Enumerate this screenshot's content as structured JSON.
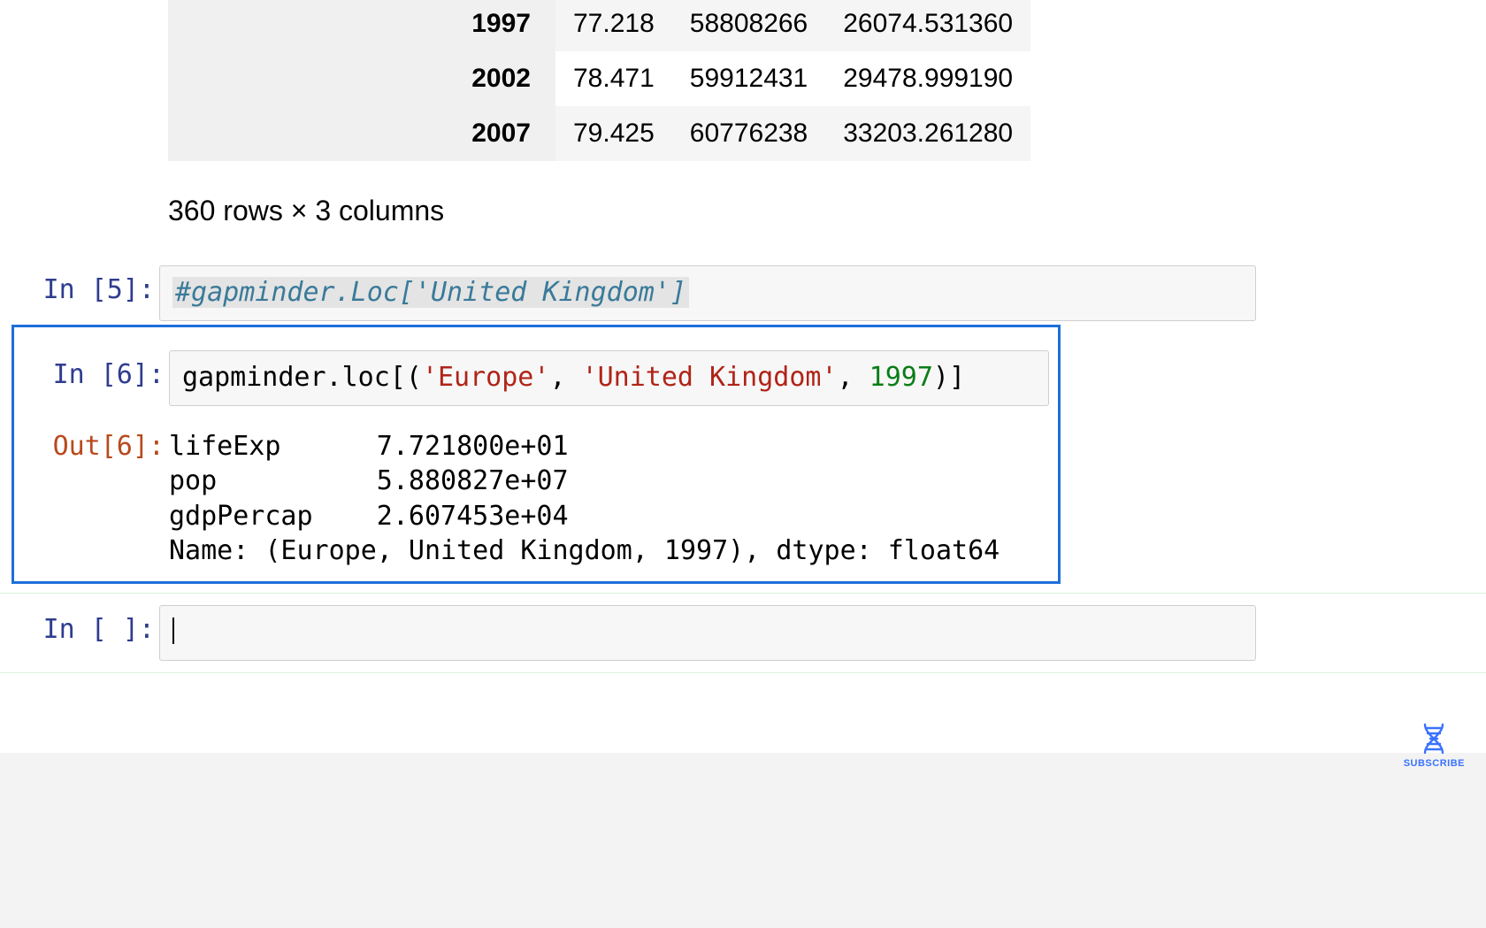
{
  "dataframe_tail": {
    "rows": [
      {
        "index": "1997",
        "lifeExp": "77.218",
        "pop": "58808266",
        "gdpPercap": "26074.531360"
      },
      {
        "index": "2002",
        "lifeExp": "78.471",
        "pop": "59912431",
        "gdpPercap": "29478.999190"
      },
      {
        "index": "2007",
        "lifeExp": "79.425",
        "pop": "60776238",
        "gdpPercap": "33203.261280"
      }
    ],
    "summary": "360 rows × 3 columns"
  },
  "cells": {
    "c5": {
      "prompt": "In [5]:",
      "code_comment": "#gapminder.Loc['United Kingdom']"
    },
    "c6": {
      "prompt_in": "In [6]:",
      "prompt_out": "Out[6]:",
      "code_prefix": "gapminder.loc[(",
      "code_str1": "'Europe'",
      "code_sep1": ", ",
      "code_str2": "'United Kingdom'",
      "code_sep2": ", ",
      "code_num": "1997",
      "code_suffix": ")]",
      "output": "lifeExp      7.721800e+01\npop          5.880827e+07\ngdpPercap    2.607453e+04\nName: (Europe, United Kingdom, 1997), dtype: float64"
    },
    "c7": {
      "prompt": "In [ ]:"
    }
  },
  "subscribe_label": "SUBSCRIBE",
  "chart_data": {
    "type": "table",
    "title": "gapminder.loc[('Europe','United Kingdom',1997)]",
    "series": [
      {
        "name": "lifeExp",
        "value": 77.218
      },
      {
        "name": "pop",
        "value": 58808266
      },
      {
        "name": "gdpPercap",
        "value": 26074.53136
      }
    ]
  }
}
